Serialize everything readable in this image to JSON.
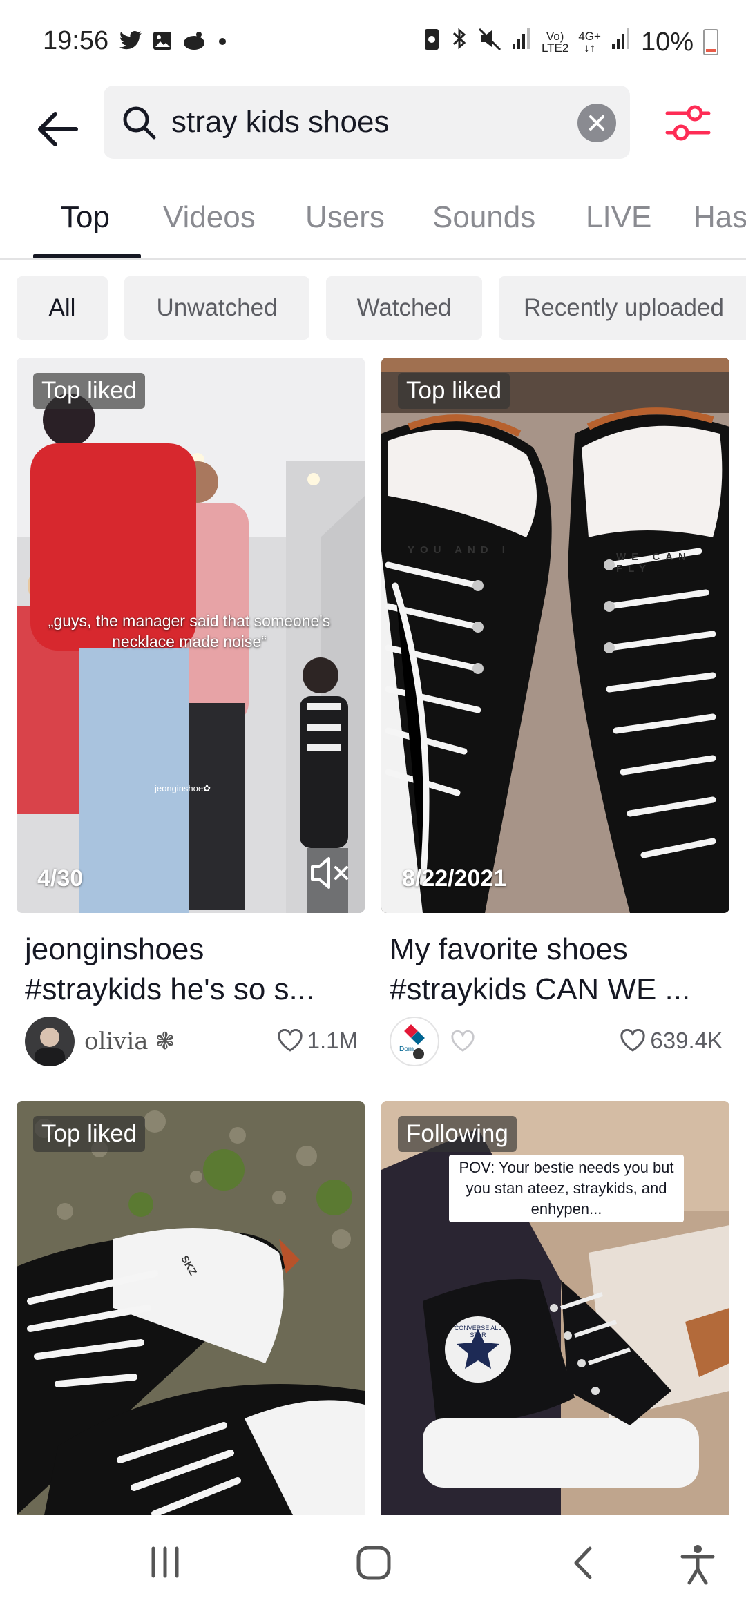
{
  "status_bar": {
    "time": "19:56",
    "volte_top": "Vo)",
    "volte_bottom": "LTE2",
    "net_top": "4G+",
    "battery": "10%",
    "icons": [
      "twitter-icon",
      "gallery-icon",
      "app-icon",
      "dot-icon",
      "screenshot-icon",
      "bluetooth-icon",
      "mute-icon",
      "signal-icon",
      "signal-icon",
      "battery-icon"
    ]
  },
  "search": {
    "query": "stray kids shoes"
  },
  "tabs": [
    {
      "label": "Top"
    },
    {
      "label": "Videos"
    },
    {
      "label": "Users"
    },
    {
      "label": "Sounds"
    },
    {
      "label": "LIVE"
    },
    {
      "label": "Has"
    }
  ],
  "chips": [
    {
      "label": "All"
    },
    {
      "label": "Unwatched"
    },
    {
      "label": "Watched"
    },
    {
      "label": "Recently uploaded"
    }
  ],
  "videos": [
    {
      "badge": "Top liked",
      "date": "4/30",
      "overlay_caption": "„guys, the manager said that someone's necklace made noise“",
      "watermark": "jeonginshoe✿",
      "title_line1": "jeonginshoes",
      "title_line2": "#straykids he's so s...",
      "author": "olivia",
      "author_emoji": "❃",
      "likes": "1.1M"
    },
    {
      "badge": "Top liked",
      "date": "8/22/2021",
      "shoe_text_left": "YOU AND I",
      "shoe_text_right": "WE CAN FLY",
      "title_line1": "My favorite shoes",
      "title_line2": "#straykids CAN WE ...",
      "author_avatar_text": "Dom",
      "likes": "639.4K"
    },
    {
      "badge": "Top liked",
      "lace_text": "SKZ"
    },
    {
      "badge": "Following",
      "pov_caption": "POV: Your bestie needs you but you stan ateez, straykids, and enhypen...",
      "logo_text": "CONVERSE ALL STAR"
    }
  ],
  "colors": {
    "accent": "#fe2c55",
    "text_primary": "#161823",
    "text_secondary": "#8a8b91",
    "chip_bg": "#f1f1f2"
  }
}
